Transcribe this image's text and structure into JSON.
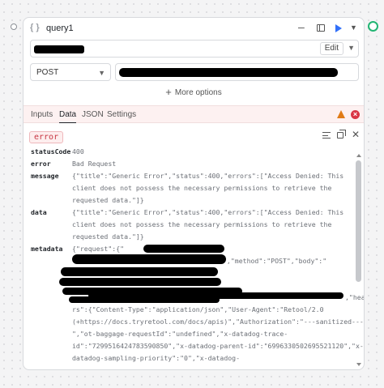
{
  "query": {
    "name": "query1",
    "icon": "braces-icon",
    "minimize_icon": "minus-icon",
    "panel_icon": "panel-icon",
    "run_icon": "play-icon",
    "more_icon": "chevron-down-icon"
  },
  "resource": {
    "edit_label": "Edit",
    "chevron": "chevron-down-icon"
  },
  "request": {
    "method": "POST",
    "more_options": "More options"
  },
  "tabs": [
    {
      "label": "Inputs",
      "active": false
    },
    {
      "label": "Data",
      "active": true
    },
    {
      "label": "JSON",
      "active": false
    },
    {
      "label": "Settings",
      "active": false
    }
  ],
  "status_colors": {
    "warning": "#e07b16",
    "error": "#d93545",
    "run": "#3170f9",
    "connected": "#22b573"
  },
  "result": {
    "badge": "error",
    "rows": [
      {
        "key": "statusCode",
        "lines": [
          "400"
        ]
      },
      {
        "key": "error",
        "lines": [
          "Bad Request"
        ]
      },
      {
        "key": "message",
        "lines": [
          "{\"title\":\"Generic Error\",\"status\":400,\"errors\":[\"Access Denied: This",
          "client does not possess the necessary permissions to retrieve the",
          "requested data.\"]}"
        ]
      },
      {
        "key": "data",
        "lines": [
          "{\"title\":\"Generic Error\",\"status\":400,\"errors\":[\"Access Denied: This",
          "client does not possess the necessary permissions to retrieve the",
          "requested data.\"]}"
        ]
      },
      {
        "key": "metadata",
        "lines": [
          "{\"request\":{\"",
          "\",\"method\":\"POST\",\"body\":\"",
          ",\"heade",
          "rs\":{\"Content-Type\":\"application/json\",\"User-Agent\":\"Retool/2.0",
          "(+https://docs.tryretool.com/docs/apis)\",\"Authorization\":\"---sanitized---",
          "\",\"ot-baggage-requestId\":\"undefined\",\"x-datadog-trace-",
          "id\":\"7299516424783590850\",\"x-datadog-parent-id\":\"6996330502695521120\",\"x-",
          "datadog-sampling-priority\":\"0\",\"x-datadog-"
        ]
      }
    ]
  }
}
